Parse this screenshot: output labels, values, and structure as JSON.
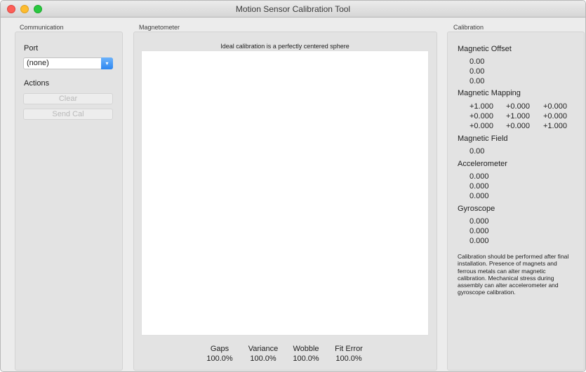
{
  "window": {
    "title": "Motion Sensor Calibration Tool"
  },
  "communication": {
    "label": "Communication",
    "port_heading": "Port",
    "port_value": "(none)",
    "actions_heading": "Actions",
    "clear_label": "Clear",
    "send_cal_label": "Send Cal"
  },
  "magnetometer": {
    "label": "Magnetometer",
    "caption": "Ideal calibration is a perfectly centered sphere",
    "metrics": [
      {
        "label": "Gaps",
        "value": "100.0%"
      },
      {
        "label": "Variance",
        "value": "100.0%"
      },
      {
        "label": "Wobble",
        "value": "100.0%"
      },
      {
        "label": "Fit Error",
        "value": "100.0%"
      }
    ]
  },
  "calibration": {
    "label": "Calibration",
    "offset_heading": "Magnetic Offset",
    "offset_values": [
      "0.00",
      "0.00",
      "0.00"
    ],
    "mapping_heading": "Magnetic Mapping",
    "mapping_rows": [
      [
        "+1.000",
        "+0.000",
        "+0.000"
      ],
      [
        "+0.000",
        "+1.000",
        "+0.000"
      ],
      [
        "+0.000",
        "+0.000",
        "+1.000"
      ]
    ],
    "field_heading": "Magnetic Field",
    "field_value": "0.00",
    "accel_heading": "Accelerometer",
    "accel_values": [
      "0.000",
      "0.000",
      "0.000"
    ],
    "gyro_heading": "Gyroscope",
    "gyro_values": [
      "0.000",
      "0.000",
      "0.000"
    ],
    "note": "Calibration should be performed after final installation.  Presence of magnets and ferrous metals can alter magnetic calibration. Mechanical stress during assembly can alter accelerometer and gyroscope calibration."
  }
}
